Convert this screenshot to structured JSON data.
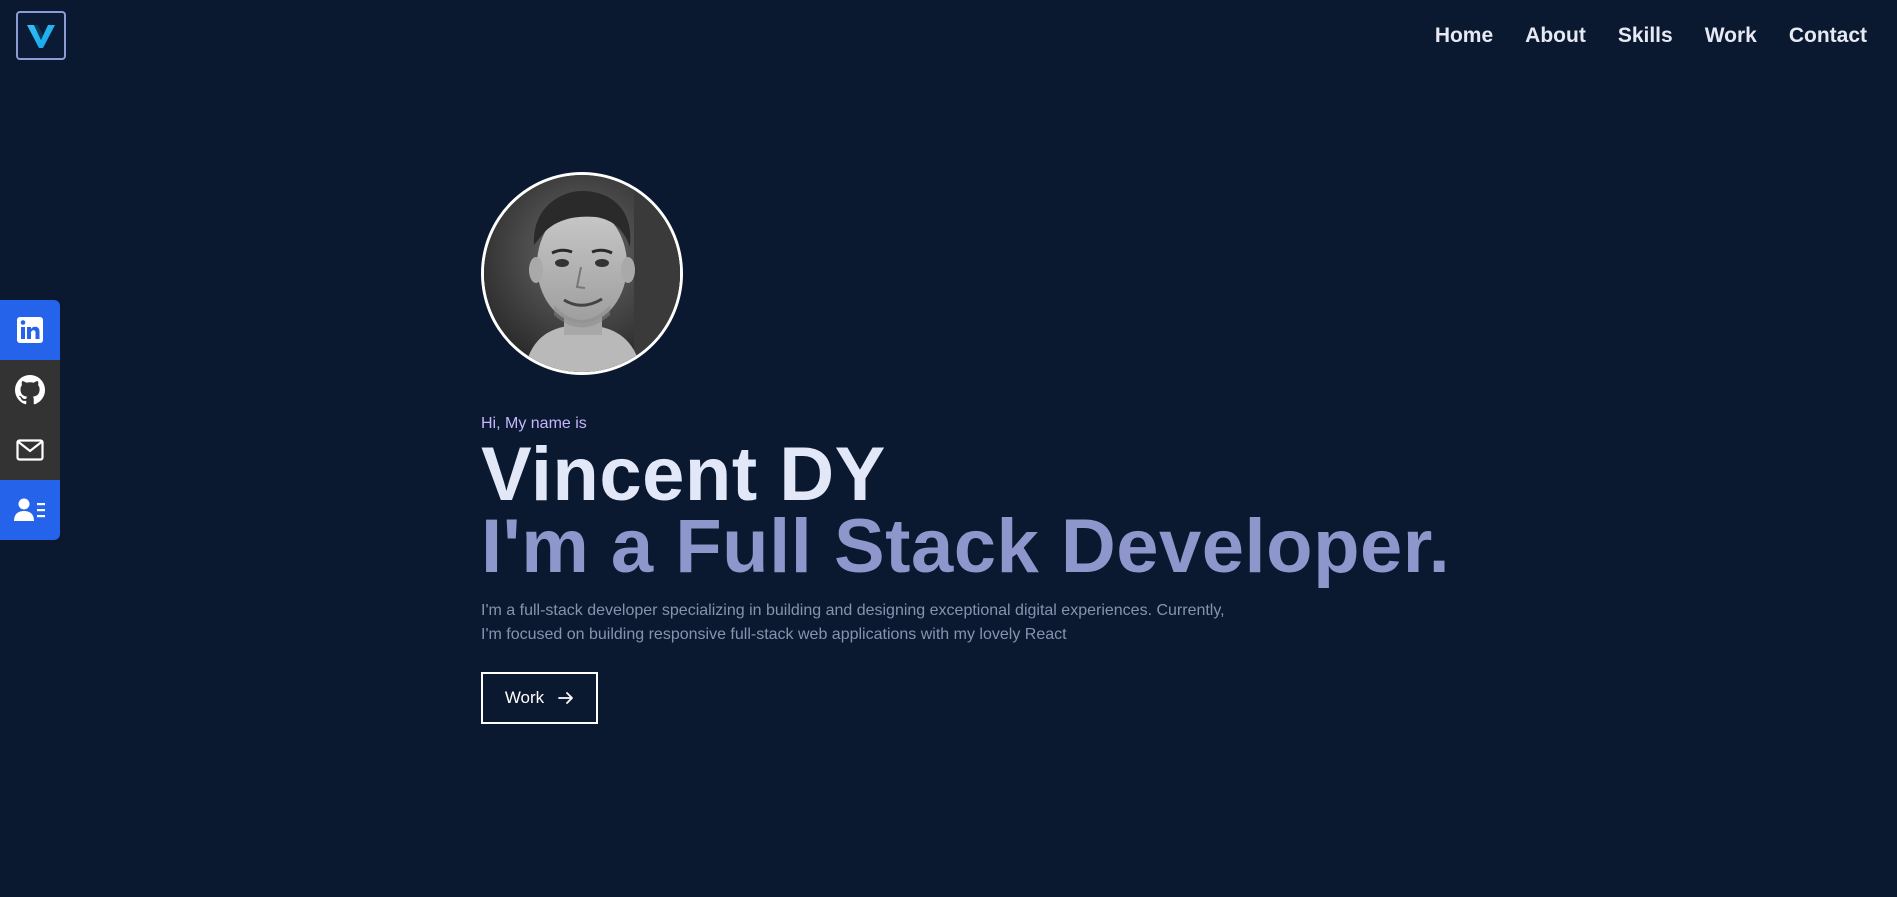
{
  "logo": {
    "icon": "v-logo-icon"
  },
  "nav": {
    "items": [
      {
        "label": "Home"
      },
      {
        "label": "About"
      },
      {
        "label": "Skills"
      },
      {
        "label": "Work"
      },
      {
        "label": "Contact"
      }
    ]
  },
  "social": [
    {
      "icon": "linkedin-icon",
      "color": "#2563eb"
    },
    {
      "icon": "github-icon",
      "color": "#333333"
    },
    {
      "icon": "mail-icon",
      "color": "#333333"
    },
    {
      "icon": "resume-icon",
      "color": "#2563eb"
    }
  ],
  "hero": {
    "greeting": "Hi, My name is",
    "name": "Vincent DY",
    "title": "I'm a Full Stack Developer.",
    "description_line1": "I'm a full-stack developer specializing in building and designing exceptional digital experiences. Currently,",
    "description_line2": "I'm focused on building responsive full-stack web applications with my lovely React",
    "button_label": "Work",
    "button_icon": "arrow-right-icon"
  },
  "colors": {
    "background": "#0a192f",
    "accent": "#2563eb",
    "heading": "#e2e8f8",
    "subheading": "#8f96cc",
    "text": "#8892b0",
    "greeting": "#c4b5fd"
  }
}
